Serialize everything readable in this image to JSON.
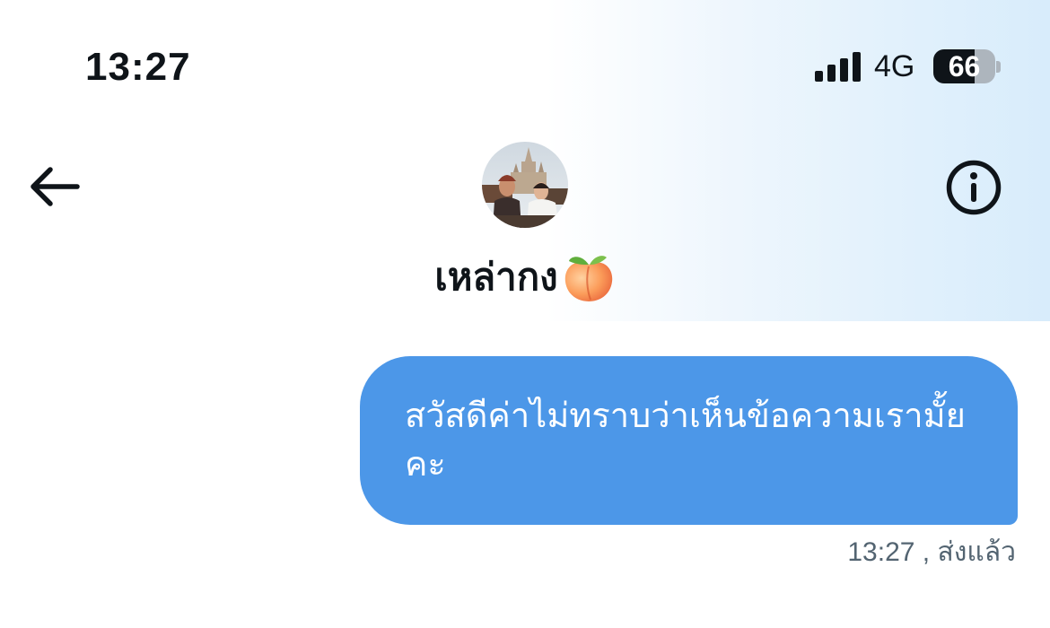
{
  "status_bar": {
    "time": "13:27",
    "network": "4G",
    "battery_level": "66",
    "signal_bars": 4
  },
  "header": {
    "contact_name": "เหล่ากง",
    "name_emoji_icon": "peach-icon",
    "back_icon": "arrow-left-icon",
    "info_icon": "info-circle-icon"
  },
  "conversation": {
    "messages": [
      {
        "direction": "sent",
        "text": "สวัสดีค่าไม่ทราบว่าเห็นข้อความเรามั้ยคะ",
        "time": "13:27",
        "status": ", ส่งแล้ว"
      }
    ]
  },
  "colors": {
    "bubble_sent": "#4c97e8",
    "text_primary": "#0f1419",
    "text_secondary": "#536471",
    "header_gradient_end": "#d8ecfb"
  }
}
